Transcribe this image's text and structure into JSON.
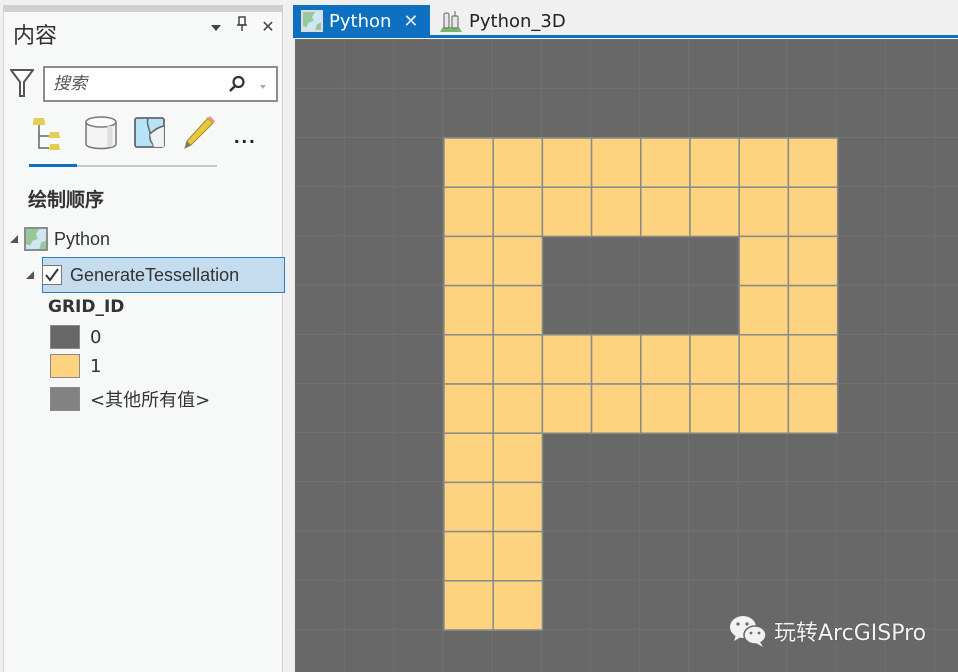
{
  "contents_pane": {
    "title": "内容",
    "actions": {
      "menu_icon": "chevron-down-icon",
      "pin_icon": "pin-icon",
      "close_icon": "close-icon",
      "pin_glyph": "⊥",
      "close_glyph": "✕"
    },
    "search": {
      "placeholder": "搜索",
      "value": ""
    },
    "toolbar": {
      "items": [
        {
          "name": "list-by-drawing-order",
          "icon": "drawing-order-icon",
          "active": true
        },
        {
          "name": "list-by-data-source",
          "icon": "data-source-icon",
          "active": false
        },
        {
          "name": "list-by-selection",
          "icon": "selection-icon",
          "active": false
        },
        {
          "name": "list-by-editing",
          "icon": "pencil-icon",
          "active": false
        }
      ],
      "more_label": "..."
    },
    "section_title": "绘制顺序",
    "tree": {
      "map": {
        "label": "Python",
        "expanded": true
      },
      "layer": {
        "label": "GenerateTessellation",
        "checked": true,
        "selected": true,
        "expanded": true
      },
      "field": "GRID_ID",
      "legend": [
        {
          "label": "0",
          "color": "#676767"
        },
        {
          "label": "1",
          "color": "#fed380"
        },
        {
          "label": "<其他所有值>",
          "color": "#828282"
        }
      ]
    }
  },
  "map_view": {
    "tabs": [
      {
        "label": "Python",
        "active": true,
        "icon": "map-icon",
        "close_glyph": "✕"
      },
      {
        "label": "Python_3D",
        "active": false,
        "icon": "scene-icon"
      }
    ],
    "colors": {
      "background": "#686868",
      "gridline": "#727272",
      "value_1": "#fed380",
      "value_0": "#676767",
      "cell_outline": "#8a8a8a",
      "accent": "#0e70c0"
    },
    "grid": {
      "rows": [
        "11111111",
        "11111111",
        "11000011",
        "11000011",
        "11111111",
        "11111111",
        "11000000",
        "11000000",
        "11000000",
        "11000000"
      ]
    },
    "watermark": "玩转ArcGISPro"
  }
}
